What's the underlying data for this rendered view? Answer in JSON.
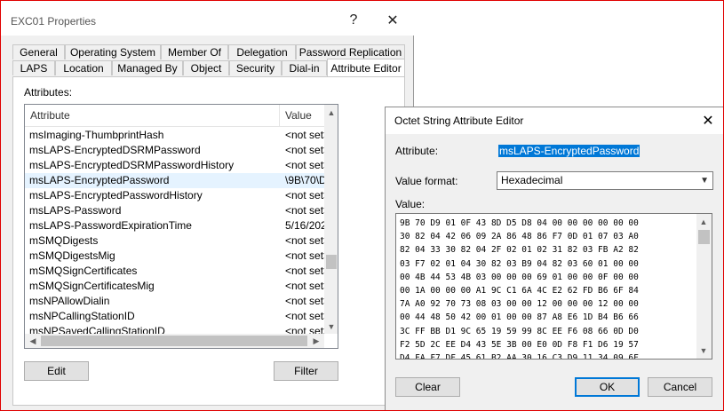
{
  "properties": {
    "title": "EXC01 Properties",
    "help_label": "?",
    "close_label": "✕",
    "tabs_row1": [
      "General",
      "Operating System",
      "Member Of",
      "Delegation",
      "Password Replication"
    ],
    "tabs_row2": [
      "LAPS",
      "Location",
      "Managed By",
      "Object",
      "Security",
      "Dial-in",
      "Attribute Editor"
    ],
    "selected_tab": "Attribute Editor",
    "attributes_label": "Attributes:",
    "columns": {
      "attribute": "Attribute",
      "value": "Value"
    },
    "rows": [
      {
        "name": "msImaging-ThumbprintHash",
        "value": "<not set>"
      },
      {
        "name": "msLAPS-EncryptedDSRMPassword",
        "value": "<not set>"
      },
      {
        "name": "msLAPS-EncryptedDSRMPasswordHistory",
        "value": "<not set>"
      },
      {
        "name": "msLAPS-EncryptedPassword",
        "value": "\\9B\\70\\D"
      },
      {
        "name": "msLAPS-EncryptedPasswordHistory",
        "value": "<not set>"
      },
      {
        "name": "msLAPS-Password",
        "value": "<not set>"
      },
      {
        "name": "msLAPS-PasswordExpirationTime",
        "value": "5/16/202"
      },
      {
        "name": "mSMQDigests",
        "value": "<not set>"
      },
      {
        "name": "mSMQDigestsMig",
        "value": "<not set>"
      },
      {
        "name": "mSMQSignCertificates",
        "value": "<not set>"
      },
      {
        "name": "mSMQSignCertificatesMig",
        "value": "<not set>"
      },
      {
        "name": "msNPAllowDialin",
        "value": "<not set>"
      },
      {
        "name": "msNPCallingStationID",
        "value": "<not set>"
      },
      {
        "name": "msNPSavedCallingStationID",
        "value": "<not set>"
      }
    ],
    "selected_row": 3,
    "edit_button": "Edit",
    "filter_button": "Filter"
  },
  "octet_editor": {
    "title": "Octet String Attribute Editor",
    "close_label": "✕",
    "attribute_label": "Attribute:",
    "attribute_value": "msLAPS-EncryptedPassword",
    "value_format_label": "Value format:",
    "value_format": "Hexadecimal",
    "value_label": "Value:",
    "hex_lines": [
      "9B 70 D9 01 0F 43 8D D5 D8 04 00 00 00 00 00 00",
      "30 82 04 42 06 09 2A 86 48 86 F7 0D 01 07 03 A0",
      "82 04 33 30 82 04 2F 02 01 02 31 82 03 FB A2 82",
      "03 F7 02 01 04 30 82 03 B9 04 82 03 60 01 00 00",
      "00 4B 44 53 4B 03 00 00 00 69 01 00 00 0F 00 00",
      "00 1A 00 00 00 A1 9C C1 6A 4C E2 62 FD B6 6F 84",
      "7A A0 92 70 73 08 03 00 00 12 00 00 00 12 00 00",
      "00 44 48 50 42 00 01 00 00 87 A8 E6 1D B4 B6 66",
      "3C FF BB D1 9C 65 19 59 99 8C EE F6 08 66 0D D0",
      "F2 5D 2C EE D4 43 5E 3B 00 E0 0D F8 F1 D6 19 57",
      "D4 FA F7 DF 45 61 B2 AA 30 16 C3 D9 11 34 09 6F"
    ],
    "clear_button": "Clear",
    "ok_button": "OK",
    "cancel_button": "Cancel"
  }
}
